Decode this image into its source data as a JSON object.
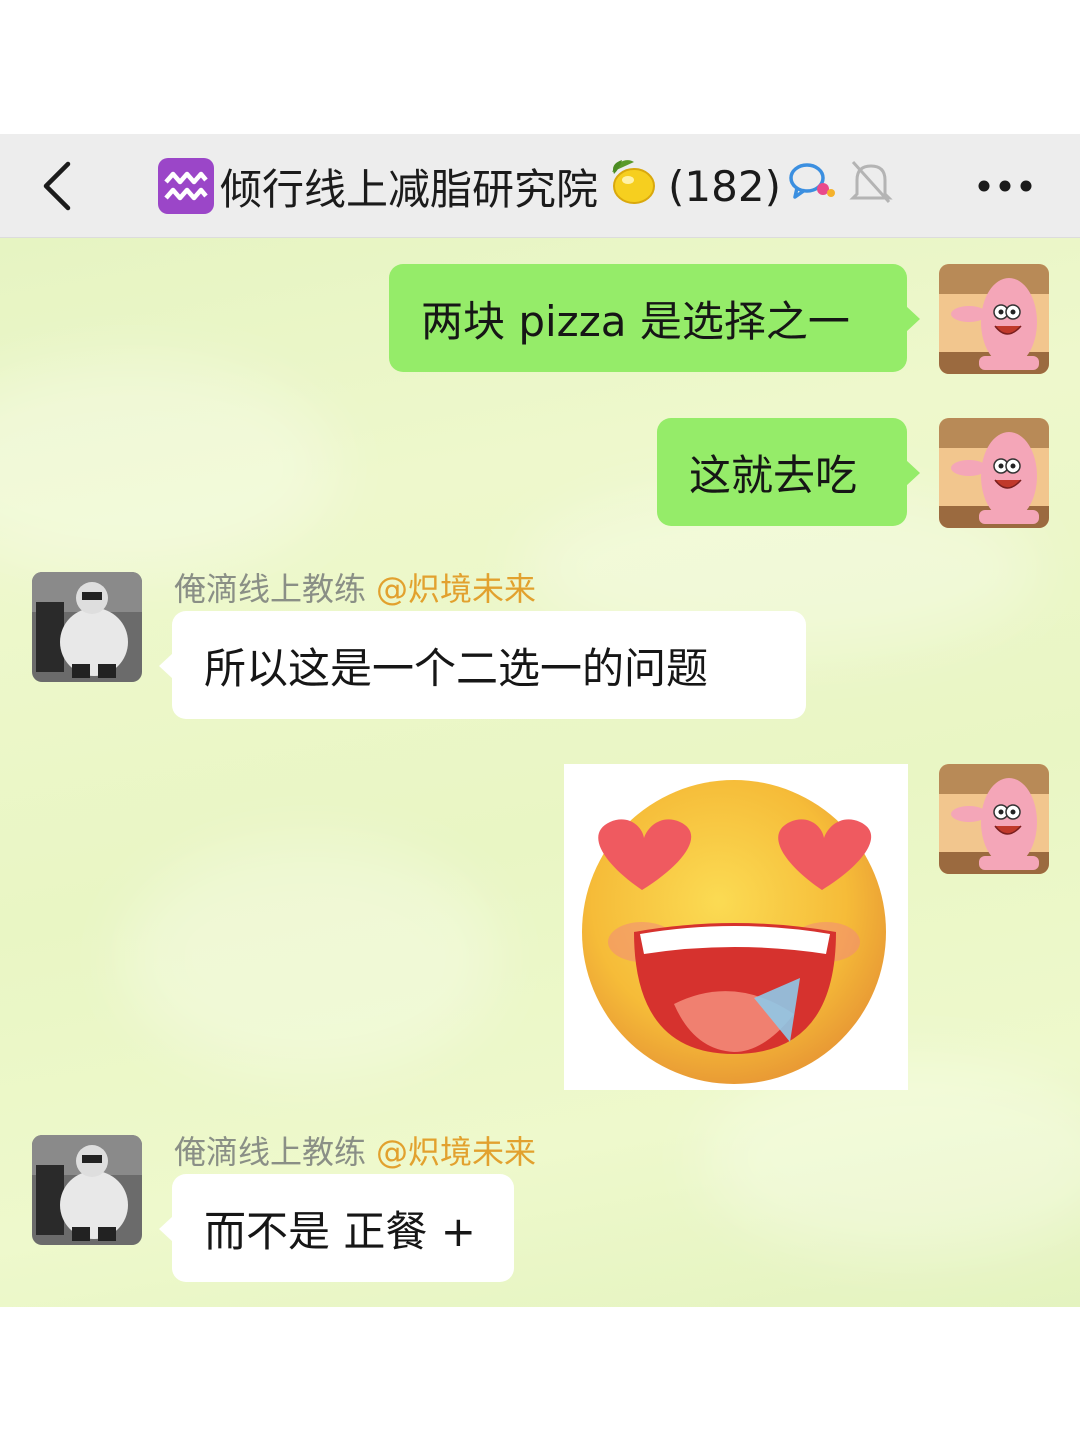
{
  "header": {
    "back_icon": "chevron-left-icon",
    "group_icon": "aquarius-icon",
    "title": "倾行线上减脂研究院",
    "title_emoji": "lemon-icon",
    "member_count": "(182)",
    "icons": [
      "chat-bubbles-icon",
      "muted-bell-icon"
    ],
    "more_icon": "more-dots-icon"
  },
  "colors": {
    "my_bubble": "#95ec69",
    "other_bubble": "#ffffff",
    "mention": "#e2a12e",
    "sender_name": "#8a8f86",
    "background": "#e9f6c4"
  },
  "messages": [
    {
      "side": "me",
      "type": "text",
      "text": "两块 pizza 是选择之一"
    },
    {
      "side": "me",
      "type": "text",
      "text": "这就去吃"
    },
    {
      "side": "other",
      "type": "text",
      "sender": "俺滴线上教练",
      "mention": "@炽境未来",
      "text": "所以这是一个二选一的问题"
    },
    {
      "side": "me",
      "type": "sticker",
      "sticker": "heart-eyes-drooling-emoji"
    },
    {
      "side": "other",
      "type": "text",
      "sender": "俺滴线上教练",
      "mention": "@炽境未来",
      "text": "而不是 正餐 +"
    }
  ]
}
